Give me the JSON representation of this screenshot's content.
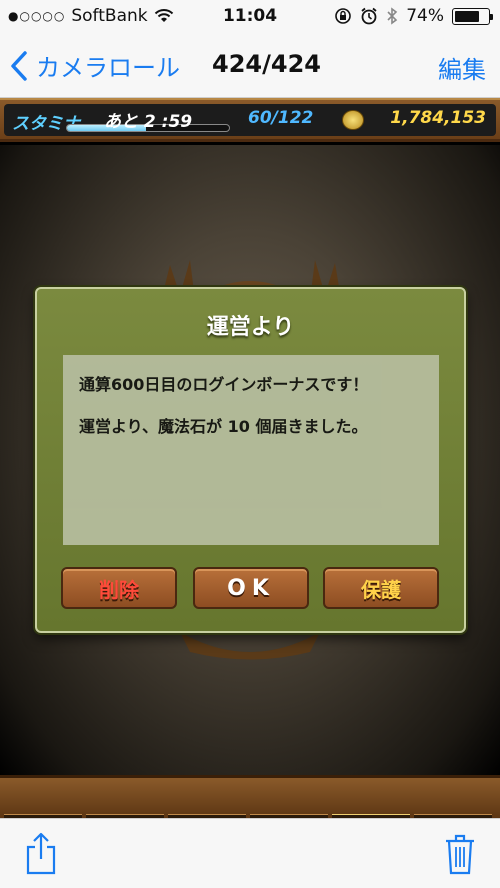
{
  "status_bar": {
    "signal": "●○○○○",
    "carrier": "SoftBank",
    "time": "11:04",
    "battery_percent": "74%",
    "battery_level": 0.74
  },
  "nav": {
    "back_label": "カメラロール",
    "title": "424/424",
    "edit_label": "編集"
  },
  "game_header": {
    "stamina_label": "スタミナ",
    "stamina_timer": "あと 2 :59",
    "stamina_fraction": 0.49,
    "stamina_count": "60/122",
    "coins": "1,784,153"
  },
  "dialog": {
    "title": "運営より",
    "message_line1": "通算600日目のログインボーナスです！",
    "message_line2": "運営より、魔法石が 10 個届きました。",
    "delete_label": "削除",
    "ok_label": "OK",
    "protect_label": "保護"
  },
  "colors": {
    "ios_blue": "#1a7cf0",
    "dialog_green": "#6f7f35",
    "button_brown": "#a05e2e",
    "delete_red": "#ff4a3a",
    "protect_gold": "#ffd24a"
  },
  "icons": {
    "back": "chevron-left-icon",
    "share": "share-icon",
    "trash": "trash-icon",
    "coin": "coin-icon",
    "wifi": "wifi-icon",
    "lock_rotation": "rotation-lock-icon",
    "alarm": "alarm-icon",
    "bluetooth": "bluetooth-icon"
  }
}
